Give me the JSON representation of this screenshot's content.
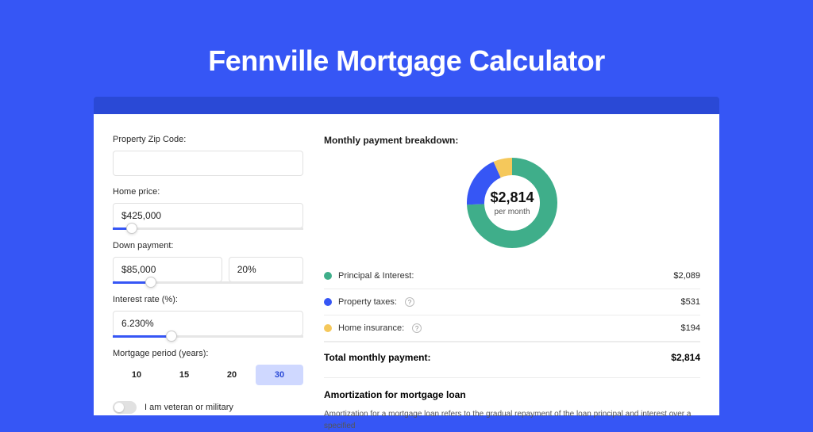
{
  "title": "Fennville Mortgage Calculator",
  "colors": {
    "accent": "#3656f5",
    "principal": "#3fae8a",
    "taxes": "#3656f5",
    "insurance": "#f5c85b"
  },
  "form": {
    "zip": {
      "label": "Property Zip Code:",
      "value": ""
    },
    "home_price": {
      "label": "Home price:",
      "value": "$425,000",
      "slider_pct": 10
    },
    "down_payment": {
      "label": "Down payment:",
      "value": "$85,000",
      "pct_value": "20%",
      "slider_pct": 20
    },
    "interest_rate": {
      "label": "Interest rate (%):",
      "value": "6.230%",
      "slider_pct": 31
    },
    "period": {
      "label": "Mortgage period (years):",
      "options": [
        "10",
        "15",
        "20",
        "30"
      ],
      "active": "30"
    },
    "veteran": {
      "label": "I am veteran or military",
      "value": false
    }
  },
  "breakdown": {
    "title": "Monthly payment breakdown:",
    "center_amount": "$2,814",
    "center_sub": "per month",
    "items": [
      {
        "label": "Principal & Interest:",
        "value": "$2,089",
        "info": false
      },
      {
        "label": "Property taxes:",
        "value": "$531",
        "info": true
      },
      {
        "label": "Home insurance:",
        "value": "$194",
        "info": true
      }
    ],
    "total_label": "Total monthly payment:",
    "total_value": "$2,814"
  },
  "amortization": {
    "title": "Amortization for mortgage loan",
    "text": "Amortization for a mortgage loan refers to the gradual repayment of the loan principal and interest over a specified"
  },
  "chart_data": {
    "type": "pie",
    "title": "Monthly payment breakdown",
    "series": [
      {
        "name": "Principal & Interest",
        "value": 2089,
        "color": "#3fae8a"
      },
      {
        "name": "Property taxes",
        "value": 531,
        "color": "#3656f5"
      },
      {
        "name": "Home insurance",
        "value": 194,
        "color": "#f5c85b"
      }
    ],
    "total": 2814,
    "ylabel": "USD per month"
  }
}
